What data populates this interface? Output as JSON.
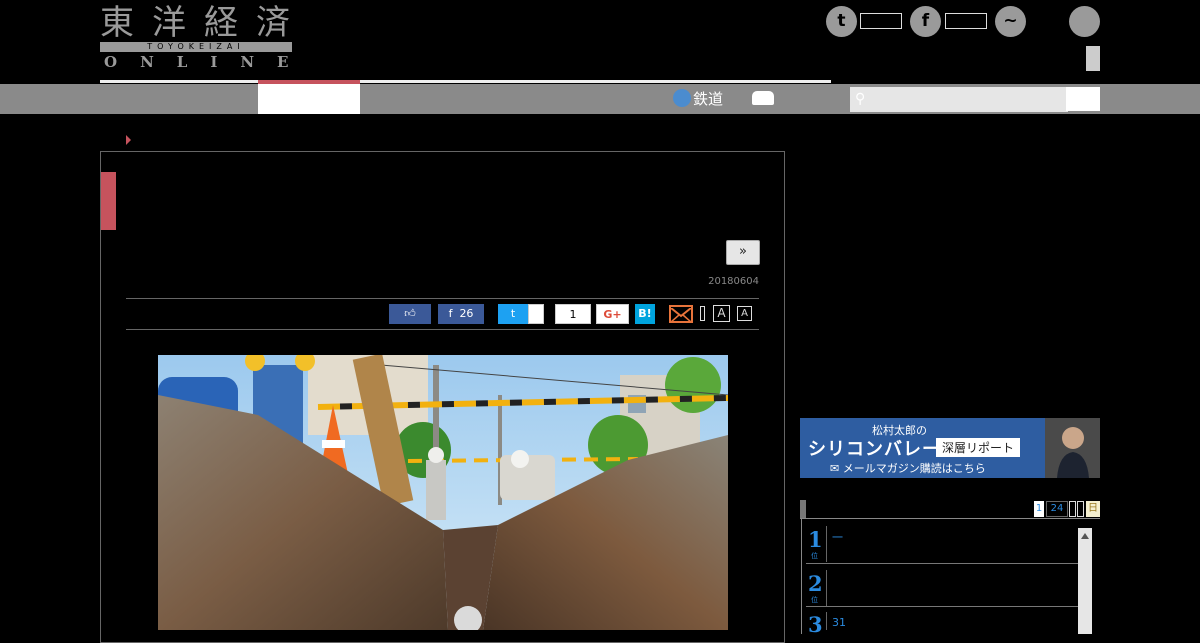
{
  "header": {
    "logo": {
      "jp": "東洋経済",
      "band": "TOYOKEIZAI",
      "en": "ONLINE"
    },
    "social": [
      {
        "name": "twitter",
        "icon": "twitter-icon",
        "glyph": "t"
      },
      {
        "name": "facebook",
        "icon": "facebook-icon",
        "glyph": "f"
      },
      {
        "name": "messenger",
        "icon": "messenger-icon",
        "glyph": "~"
      }
    ]
  },
  "nav": {
    "rail_label": "鉄道",
    "search_placeholder": ""
  },
  "article": {
    "next_label": "»",
    "date": "20180604",
    "share": {
      "facebook_count": "26",
      "pocket_count": "1",
      "gplus_label": "G+",
      "hatena_label": "B!",
      "font_large": "A",
      "font_small": "A"
    }
  },
  "banner": {
    "line1": "松村太郎の",
    "line2": "シリコンバレー",
    "line3": "深層リポート",
    "line4": "メールマガジン購読はこちら"
  },
  "ranking": {
    "tabs": [
      "1",
      "24",
      "",
      "",
      "日"
    ],
    "items": [
      {
        "rank": "1",
        "title": "一"
      },
      {
        "rank": "2",
        "title": ""
      },
      {
        "rank": "3",
        "title": "31"
      }
    ]
  },
  "colors": {
    "accent": "#c6535d",
    "nav_gray": "#8a8a8a",
    "rank_blue": "#2b8be0"
  }
}
